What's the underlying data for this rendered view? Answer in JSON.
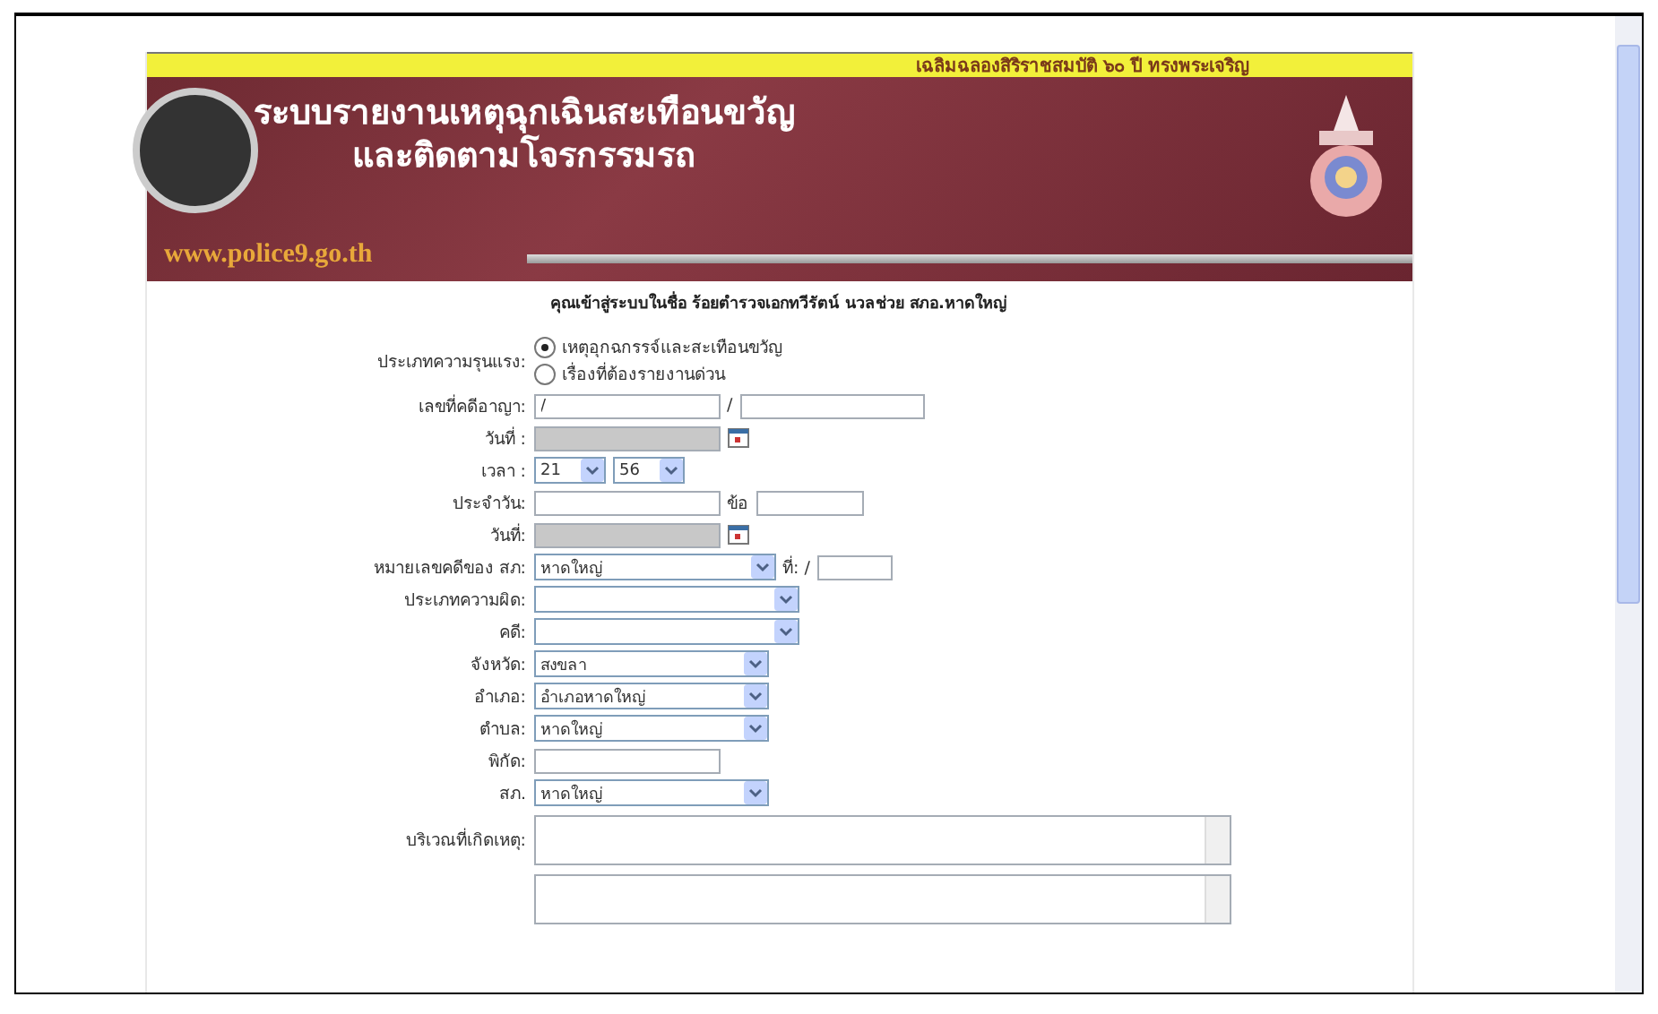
{
  "banner": {
    "strip_text": "เฉลิมฉลองสิริราชสมบัติ ๖๐ ปี ทรงพระเจริญ",
    "title_lines": [
      "ระบบรายงานเหตุฉุกเฉินสะเทือนขวัญ",
      "และติดตามโจรกรรมรถ"
    ],
    "url": "www.police9.go.th"
  },
  "login_text": "คุณเข้าสู่ระบบในชื่อ ร้อยตำรวจเอกทวีรัตน์ นวลช่วย  สภอ.หาดใหญ่",
  "form": [
    {
      "kind": "radio",
      "label": "ประเภทความรุนแรง:",
      "options": [
        {
          "label": "เหตุอุกฉกรรจ์และสะเทือนขวัญ",
          "selected": true
        },
        {
          "label": "เรื่องที่ต้องรายงานด่วน",
          "selected": false
        }
      ]
    },
    {
      "kind": "case",
      "label": "เลขที่คดีอาญา:",
      "value": "/",
      "separator": "/"
    },
    {
      "kind": "date",
      "label": "วันที่ :"
    },
    {
      "kind": "time",
      "label": "เวลา :",
      "hour": "21",
      "minute": "56"
    },
    {
      "kind": "pair",
      "label": "ประจำวัน:",
      "second_label": "ข้อ"
    },
    {
      "kind": "date",
      "label": "วันที่:"
    },
    {
      "kind": "select_no",
      "label": "หมายเลขคดีของ สภ:",
      "value": "หาดใหญ่",
      "second_label": "ที่: /"
    },
    {
      "kind": "wideselect",
      "label": "ประเภทความผิด:"
    },
    {
      "kind": "wideselect",
      "label": "คดี:"
    },
    {
      "kind": "select",
      "label": "จังหวัด:",
      "value": "สงขลา"
    },
    {
      "kind": "select",
      "label": "อำเภอ:",
      "value": "อำเภอหาดใหญ่"
    },
    {
      "kind": "select",
      "label": "ตำบล:",
      "value": "หาดใหญ่"
    },
    {
      "kind": "text",
      "label": "พิกัด:"
    },
    {
      "kind": "select",
      "label": "สภ.",
      "value": "หาดใหญ่"
    },
    {
      "kind": "textarea",
      "label": "บริเวณที่เกิดเหตุ:"
    },
    {
      "kind": "textarea"
    }
  ]
}
